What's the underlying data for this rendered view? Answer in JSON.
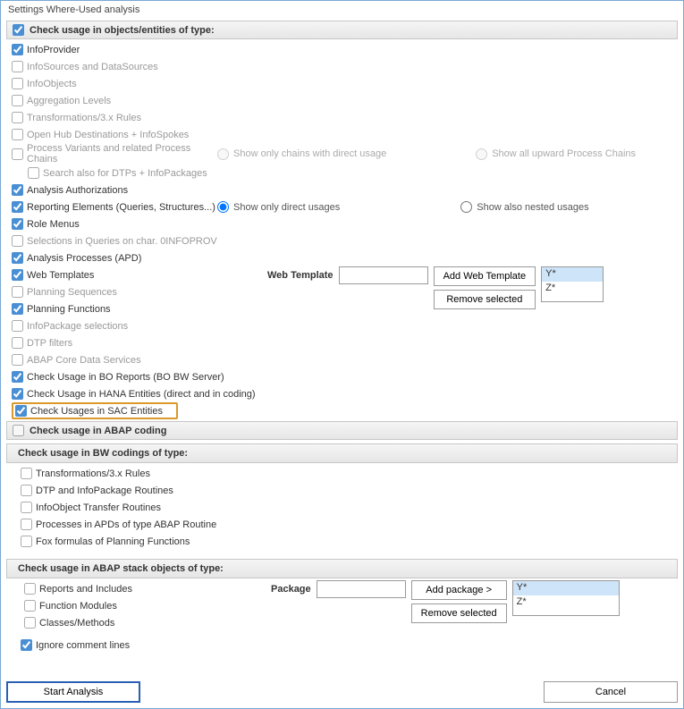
{
  "window": {
    "title": "Settings Where-Used analysis"
  },
  "section1": {
    "title": "Check usage in objects/entities of type:",
    "infoprovider": "InfoProvider",
    "infosources": "InfoSources and DataSources",
    "infoobjects": "InfoObjects",
    "agg_levels": "Aggregation Levels",
    "transformations": "Transformations/3.x Rules",
    "open_hub": "Open Hub Destinations + InfoSpokes",
    "process_variants": "Process Variants and related Process Chains",
    "pv_radio1": "Show only chains with direct usage",
    "pv_radio2": "Show all upward Process Chains",
    "search_dtps": "Search also for DTPs + InfoPackages",
    "analysis_auth": "Analysis Authorizations",
    "reporting_elements": "Reporting Elements (Queries, Structures...)",
    "re_radio1": "Show only direct usages",
    "re_radio2": "Show also nested usages",
    "role_menus": "Role Menus",
    "selections_in_queries": "Selections in Queries on char. 0INFOPROV",
    "analysis_processes": "Analysis Processes (APD)",
    "web_templates": "Web Templates",
    "wt_label": "Web Template",
    "wt_add": "Add Web Template",
    "wt_remove": "Remove selected",
    "wt_list": [
      "Y*",
      "Z*"
    ],
    "planning_sequences": "Planning Sequences",
    "planning_functions": "Planning Functions",
    "infopackage_selections": "InfoPackage selections",
    "dtp_filters": "DTP filters",
    "abap_cds": "ABAP Core Data Services",
    "bo_reports": "Check Usage in BO Reports (BO  BW Server)",
    "hana_entities": "Check Usage in HANA Entities (direct and in coding)",
    "sac_entities": "Check Usages in SAC Entities"
  },
  "section2": {
    "title": "Check usage in ABAP coding"
  },
  "section3": {
    "title": "Check usage in BW codings of type:",
    "transformations": "Transformations/3.x Rules",
    "dtp_routines": "DTP and InfoPackage Routines",
    "infoobject_transfer": "InfoObject Transfer Routines",
    "apd_abap": "Processes in APDs of type ABAP Routine",
    "fox_formulas": "Fox formulas of Planning Functions"
  },
  "section4": {
    "title": "Check usage in ABAP stack objects of type:",
    "reports_includes": "Reports and Includes",
    "function_modules": "Function Modules",
    "classes_methods": "Classes/Methods",
    "ignore_comments": "Ignore comment lines",
    "package_label": "Package",
    "add_package": "Add package >",
    "remove_selected": "Remove selected",
    "pkg_list": [
      "Y*",
      "Z*"
    ]
  },
  "footer": {
    "start": "Start Analysis",
    "cancel": "Cancel"
  }
}
